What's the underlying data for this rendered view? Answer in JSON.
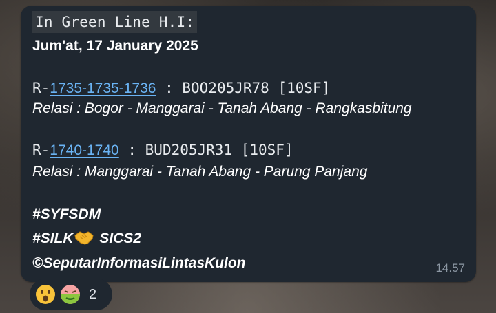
{
  "message": {
    "header": "In Green Line H.I:",
    "date": "Jum'at, 17 January 2025",
    "trains": [
      {
        "prefix": "R-",
        "link": "1735-1735-1736",
        "detail": " : BOO205JR78 [10SF]",
        "relasi": "Relasi : Bogor - Manggarai - Tanah Abang - Rangkasbitung"
      },
      {
        "prefix": "R-",
        "link": "1740-1740",
        "detail": " : BUD205JR31 [10SF]",
        "relasi": "Relasi : Manggarai - Tanah Abang - Parung Panjang"
      }
    ],
    "tags": {
      "line1": "#SYFSDM",
      "line2_a": "#SILK",
      "line2_b": " SICS2",
      "line3": "©SeputarInformasiLintasKulon"
    },
    "time": "14.57"
  },
  "reactions": {
    "emojis": [
      "astonished-face",
      "nauseated-face"
    ],
    "count": "2"
  },
  "colors": {
    "bubble": "#1f2730",
    "link": "#6ab3f3",
    "time": "#8d98a4"
  }
}
